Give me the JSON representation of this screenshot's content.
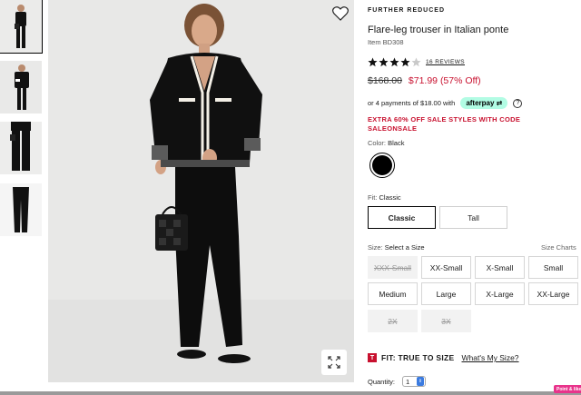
{
  "thumbnails": [
    {
      "label": "thumbnail-1"
    },
    {
      "label": "thumbnail-2"
    },
    {
      "label": "thumbnail-3"
    },
    {
      "label": "thumbnail-4"
    }
  ],
  "product": {
    "badge": "FURTHER REDUCED",
    "title": "Flare-leg trouser in Italian ponte",
    "item_no": "Item BD308",
    "rating": 4,
    "rating_max": 5,
    "reviews": "16 REVIEWS",
    "price_old": "$168.00",
    "price_new": "$71.99",
    "price_off": "(57% Off)"
  },
  "payment": {
    "text": "or 4 payments of $18.00 with",
    "provider": "afterpay",
    "info": "?"
  },
  "promo": "EXTRA 60% OFF SALE STYLES WITH CODE SALEONSALE",
  "color": {
    "label": "Color:",
    "value": "Black",
    "swatch": "#000000"
  },
  "fit": {
    "label": "Fit:",
    "value": "Classic",
    "options": [
      {
        "label": "Classic",
        "selected": true
      },
      {
        "label": "Tall",
        "selected": false
      }
    ]
  },
  "size": {
    "label": "Size:",
    "value": "Select a Size",
    "charts_link": "Size Charts",
    "options": [
      {
        "label": "XXX-Small",
        "available": false
      },
      {
        "label": "XX-Small",
        "available": true
      },
      {
        "label": "X-Small",
        "available": true
      },
      {
        "label": "Small",
        "available": true
      },
      {
        "label": "Medium",
        "available": true
      },
      {
        "label": "Large",
        "available": true
      },
      {
        "label": "X-Large",
        "available": true
      },
      {
        "label": "XX-Large",
        "available": true
      },
      {
        "label": "2X",
        "available": false
      },
      {
        "label": "3X",
        "available": false
      }
    ]
  },
  "fit_note": {
    "icon": "T",
    "text": "FIT: TRUE TO SIZE",
    "link": "What's My Size?"
  },
  "quantity": {
    "label": "Quantity:",
    "value": "1"
  },
  "feedback": "Point & like",
  "colors": {
    "sale": "#c8102e",
    "afterpay": "#b2fce4",
    "selected_border": "#000000"
  }
}
